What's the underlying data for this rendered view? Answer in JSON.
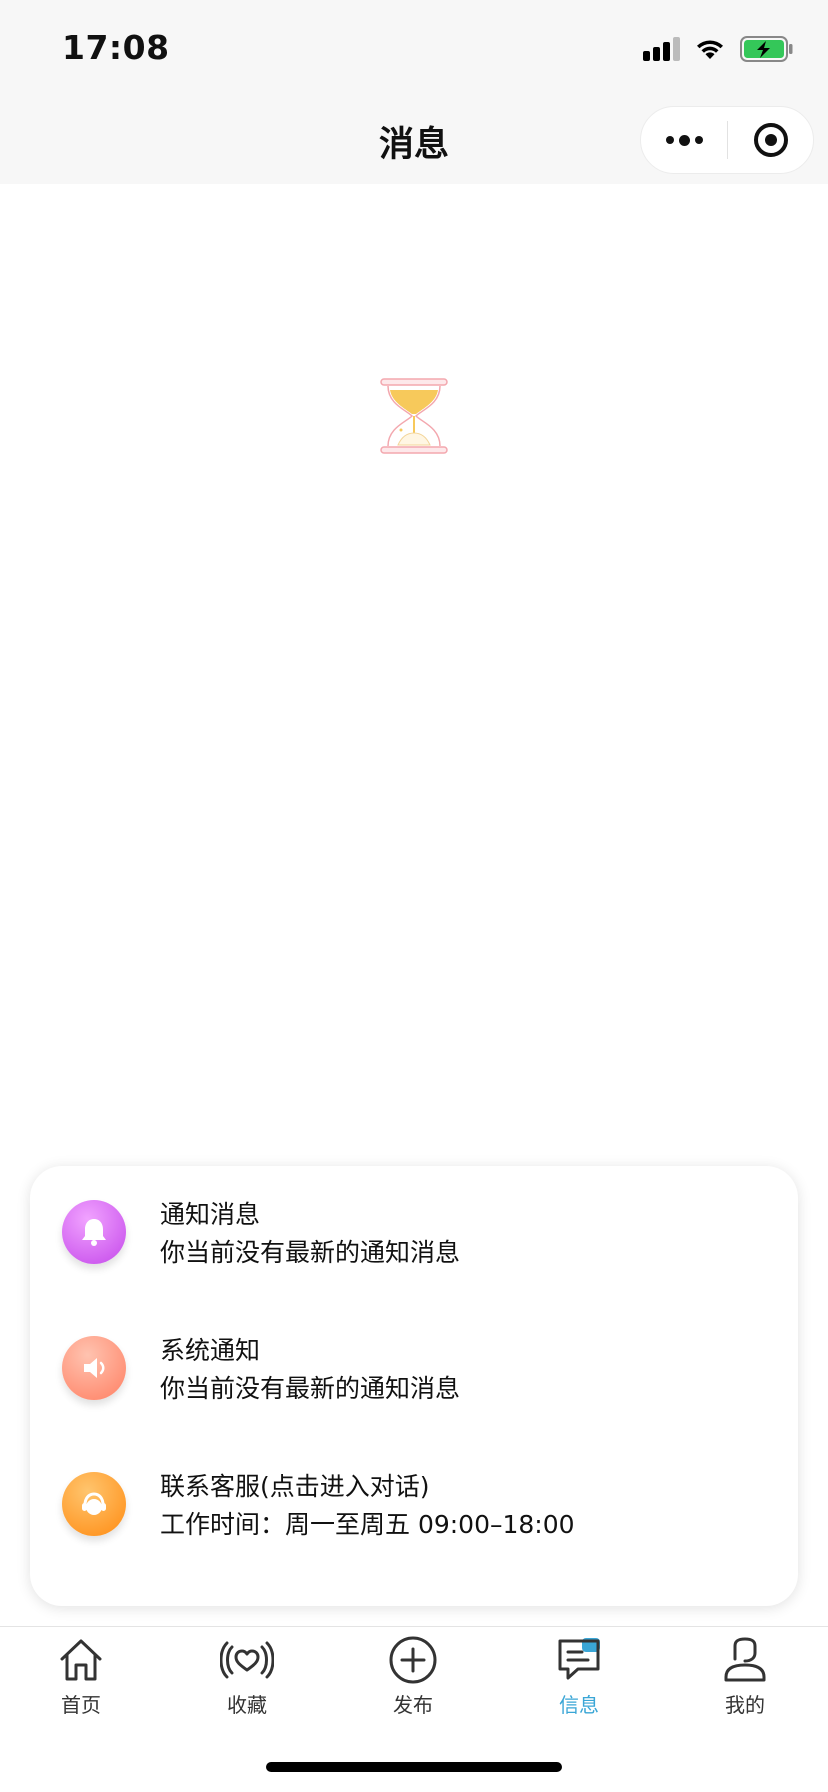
{
  "status_bar": {
    "time": "17:08"
  },
  "nav": {
    "title": "消息"
  },
  "messages": [
    {
      "title": "通知消息",
      "subtitle": "你当前没有最新的通知消息",
      "icon": "bell-icon",
      "color": "#d15ef0"
    },
    {
      "title": "系统通知",
      "subtitle": "你当前没有最新的通知消息",
      "icon": "speaker-icon",
      "color": "#ff8a6e"
    },
    {
      "title": "联系客服(点击进入对话)",
      "subtitle": "工作时间：周一至周五 09:00–18:00",
      "icon": "customer-service-icon",
      "color": "#ff9a2a"
    }
  ],
  "tabs": [
    {
      "label": "首页",
      "icon": "home-icon"
    },
    {
      "label": "收藏",
      "icon": "favorite-icon"
    },
    {
      "label": "发布",
      "icon": "publish-plus-icon"
    },
    {
      "label": "信息",
      "icon": "message-icon",
      "active": true
    },
    {
      "label": "我的",
      "icon": "profile-icon"
    }
  ],
  "colors": {
    "accent": "#3aa6d6",
    "background": "#ffffff",
    "bar": "#f7f7f7"
  }
}
